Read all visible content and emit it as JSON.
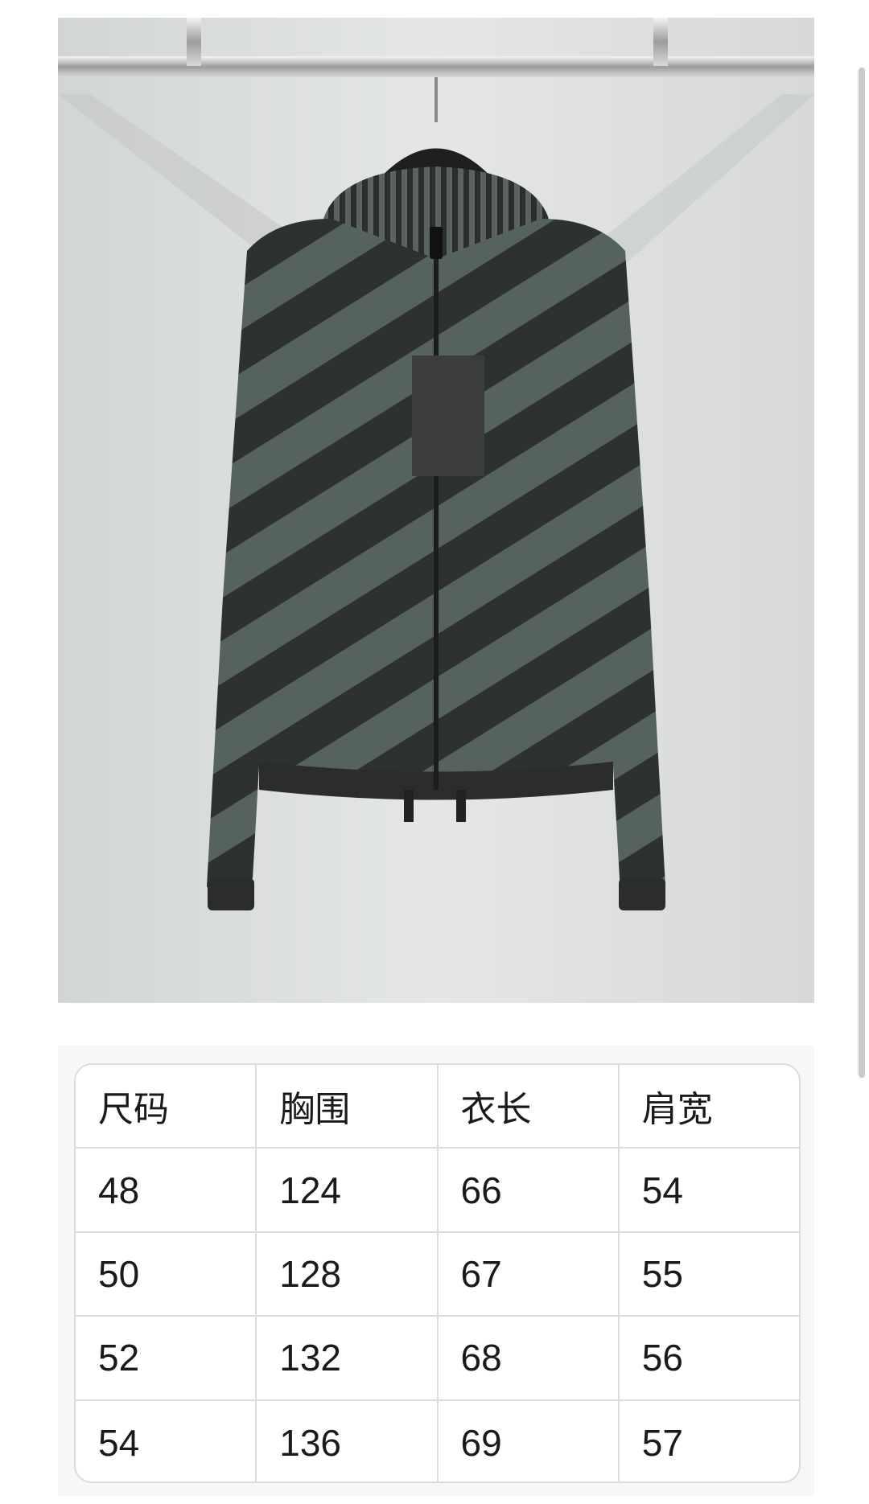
{
  "product_photo": {
    "subject": "jacket-photo"
  },
  "size_table": {
    "headers": [
      "尺码",
      "胸围",
      "衣长",
      "肩宽"
    ],
    "rows": [
      [
        "48",
        "124",
        "66",
        "54"
      ],
      [
        "50",
        "128",
        "67",
        "55"
      ],
      [
        "52",
        "132",
        "68",
        "56"
      ],
      [
        "54",
        "136",
        "69",
        "57"
      ]
    ]
  },
  "colors": {
    "stripe_dark": "#2e3132",
    "stripe_light": "#556260",
    "table_border": "#dcdcdc",
    "text": "#1a1a1a"
  }
}
